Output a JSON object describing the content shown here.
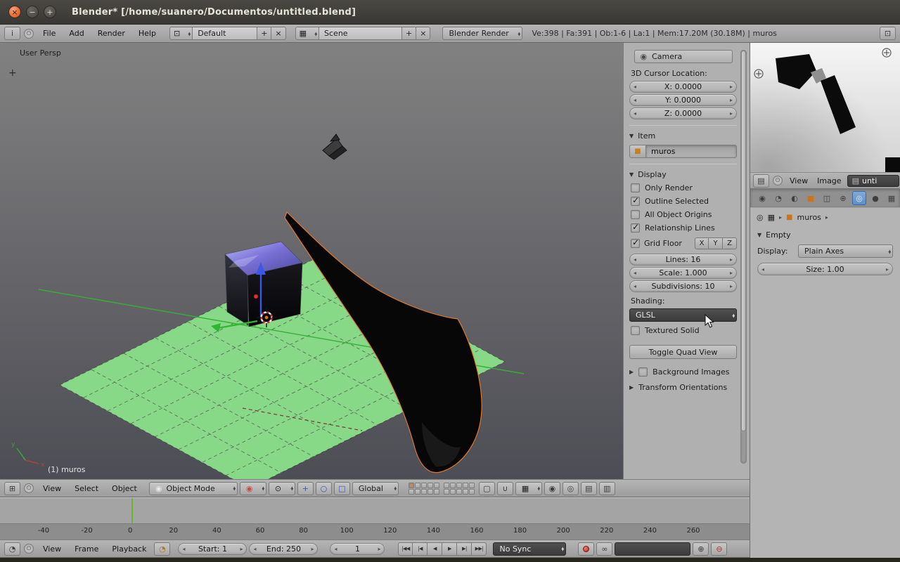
{
  "window": {
    "title": "Blender* [/home/suanero/Documentos/untitled.blend]"
  },
  "icons": {
    "close": "×",
    "minimize": "−",
    "maximize": "+",
    "info": "i",
    "circle_menu": "⊙",
    "editor_3d_view": "⊞",
    "editor_timeline": "◔",
    "editor_image": "▤",
    "screen_layout": "⊡",
    "camera": "◉",
    "cube": "■",
    "photo": "▤",
    "mode_dot": "◉",
    "shading_ball": "◉",
    "pivot": "⊙",
    "manip_translate": "+",
    "manip_rotate": "○",
    "manip_scale": "□",
    "lock": "▢",
    "magnet": "∪",
    "snap_grid": "▦",
    "prop_edit": "◉",
    "prop_falloff": "◎",
    "render_view_a": "▤",
    "render_view_b": "▥",
    "preview_clock": "◔",
    "autokey_link": "∞",
    "keyset_add": "⊕",
    "keyset_remove": "⊖",
    "pin": "◎",
    "scene_small": "▦",
    "crumb_sep": "▸",
    "collapse_open": "▼",
    "collapse_closed": "▶",
    "toolshelf_plus": "+",
    "zoom_target": "⊕"
  },
  "infobar": {
    "menus": [
      {
        "label": "File"
      },
      {
        "label": "Add"
      },
      {
        "label": "Render"
      },
      {
        "label": "Help"
      }
    ],
    "layout": {
      "value": "Default"
    },
    "scene": {
      "value": "Scene"
    },
    "engine": {
      "value": "Blender Render"
    },
    "stats": "Ve:398 | Fa:391 | Ob:1-6 | La:1 | Mem:17.20M (30.18M) | muros"
  },
  "viewport": {
    "view_label": "User Persp",
    "active_object_label": "(1) muros",
    "axis_x_label": "x",
    "axis_y_label": "y",
    "header": {
      "menus": [
        "View",
        "Select",
        "Object"
      ],
      "mode_selector": "Object Mode",
      "orientation_selector": "Global",
      "layers": {
        "groups": [
          10,
          10
        ],
        "active_index": 0
      }
    }
  },
  "npanel": {
    "camera_button": "Camera",
    "cursor": {
      "label": "3D Cursor Location:",
      "x": "X: 0.0000",
      "y": "Y: 0.0000",
      "z": "Z: 0.0000"
    },
    "item": {
      "title": "Item",
      "name": "muros"
    },
    "display": {
      "title": "Display",
      "checkboxes": [
        {
          "label": "Only Render",
          "checked": false
        },
        {
          "label": "Outline Selected",
          "checked": true
        },
        {
          "label": "All Object Origins",
          "checked": false
        },
        {
          "label": "Relationship Lines",
          "checked": true
        }
      ],
      "grid_floor": {
        "label": "Grid Floor",
        "checked": true,
        "axis_buttons": [
          "X",
          "Y",
          "Z"
        ]
      },
      "sliders": [
        "Lines: 16",
        "Scale: 1.000",
        "Subdivisions: 10"
      ],
      "shading_label": "Shading:",
      "shading_value": "GLSL",
      "textured_solid": {
        "label": "Textured Solid",
        "checked": false
      },
      "toggle_quad_button": "Toggle Quad View"
    },
    "collapsed": [
      {
        "label": "Background Images",
        "has_checkbox": true
      },
      {
        "label": "Transform Orientations",
        "has_checkbox": false
      }
    ]
  },
  "image_editor": {
    "menus": [
      "View",
      "Image"
    ],
    "image_name": "unti"
  },
  "properties": {
    "tabs": [
      {
        "name": "render",
        "glyph": "◉",
        "active": false
      },
      {
        "name": "scene",
        "glyph": "◔",
        "active": false
      },
      {
        "name": "world",
        "glyph": "◐",
        "active": false
      },
      {
        "name": "object",
        "glyph": "■",
        "active": false,
        "tint": "object"
      },
      {
        "name": "constraints",
        "glyph": "◫",
        "active": false
      },
      {
        "name": "modifiers",
        "glyph": "⊕",
        "active": false
      },
      {
        "name": "object-data",
        "glyph": "◎",
        "active": true
      },
      {
        "name": "material",
        "glyph": "●",
        "active": false
      },
      {
        "name": "texture",
        "glyph": "▦",
        "active": false
      }
    ],
    "breadcrumb": {
      "object": "muros"
    },
    "empty_panel": {
      "title": "Empty",
      "display_label": "Display:",
      "display_value": "Plain Axes",
      "size": "Size: 1.00"
    }
  },
  "timeline": {
    "ticks": [
      "-40",
      "-20",
      "0",
      "20",
      "40",
      "60",
      "80",
      "100",
      "120",
      "140",
      "160",
      "180",
      "200",
      "220",
      "240",
      "260"
    ],
    "header": {
      "menus": [
        "View",
        "Frame",
        "Playback"
      ],
      "start": "Start: 1",
      "end": "End: 250",
      "current_frame": "1",
      "transport": [
        "|◀◀",
        "|◀",
        "◀",
        "▶",
        "▶|",
        "▶▶|"
      ],
      "sync_mode": "No Sync"
    }
  }
}
